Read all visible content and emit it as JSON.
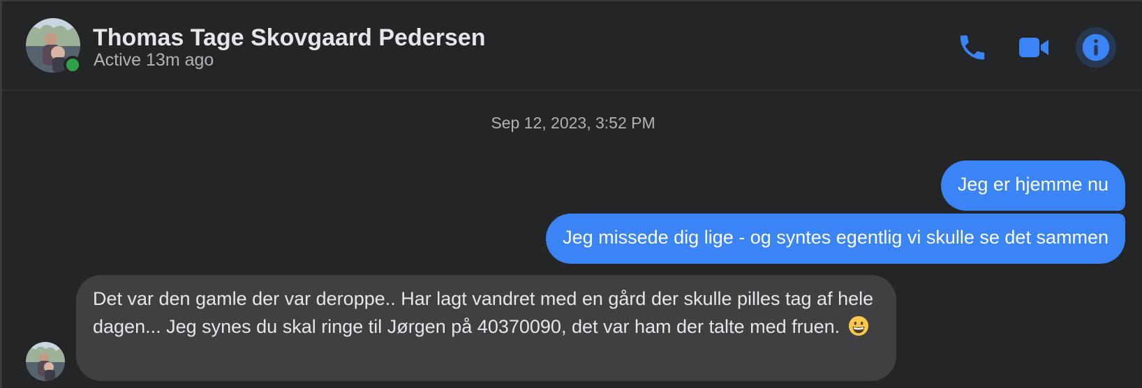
{
  "header": {
    "contact_name": "Thomas Tage Skovgaard Pedersen",
    "status": "Active 13m ago",
    "actions": {
      "call_icon": "phone-icon",
      "video_icon": "video-camera-icon",
      "info_icon": "info-icon"
    }
  },
  "conversation": {
    "timestamp": "Sep 12, 2023, 3:52 PM",
    "messages": [
      {
        "direction": "outgoing",
        "text": "Jeg er hjemme nu"
      },
      {
        "direction": "outgoing",
        "text": "Jeg missede dig lige - og syntes egentlig vi skulle se det sammen"
      },
      {
        "direction": "incoming",
        "text": "Det var den gamle der var deroppe.. Har lagt vandret med en gård der skulle pilles tag af hele dagen... Jeg synes du skal ringe til Jørgen på 40370090, det var ham der talte med fruen.",
        "emoji": "grinning-face-emoji"
      }
    ]
  },
  "colors": {
    "background": "#242526",
    "accent": "#3a84f5",
    "incoming_bubble": "#3e4042",
    "online": "#31a24c",
    "text_primary": "#e4e6eb",
    "text_secondary": "#b0b3b8"
  }
}
